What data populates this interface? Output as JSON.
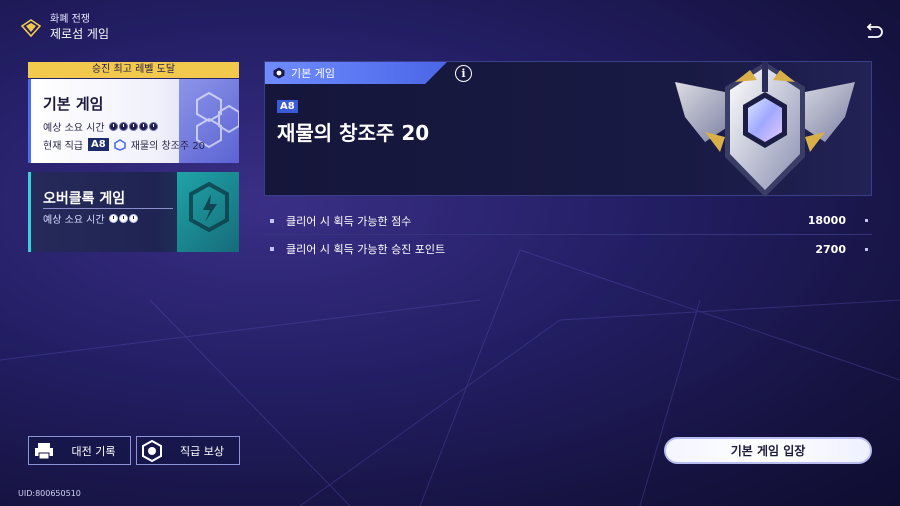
{
  "header": {
    "subtitle": "화폐 전쟁",
    "title": "제로섬 게임"
  },
  "left_panel": {
    "max_banner": "승진 최고 레벨 도달",
    "basic_card": {
      "title": "기본 게임",
      "time_label": "예상 소요 시간",
      "time_clocks": 5,
      "rank_label": "현재 직급",
      "rank_badge": "A8",
      "rank_name": "재물의 창조주 20"
    },
    "overclock_card": {
      "title": "오버클록 게임",
      "time_label": "예상 소요 시간",
      "time_clocks": 3
    }
  },
  "main_panel": {
    "tab_label": "기본 게임",
    "info_icon": "i",
    "rank_chip": "A8",
    "title": "재물의 창조주 20"
  },
  "rewards": [
    {
      "label": "클리어 시 획득 가능한 점수",
      "value": "18000"
    },
    {
      "label": "클리어 시 획득 가능한 승진 포인트",
      "value": "2700"
    }
  ],
  "bottom": {
    "history_label": "대전 기록",
    "rank_reward_label": "직급 보상",
    "enter_label": "기본 게임 입장",
    "uid": "UID:800650510"
  },
  "colors": {
    "accent_blue": "#4b66e6",
    "banner_yellow": "#f2c94c",
    "overclock_teal": "#35d2d8"
  }
}
